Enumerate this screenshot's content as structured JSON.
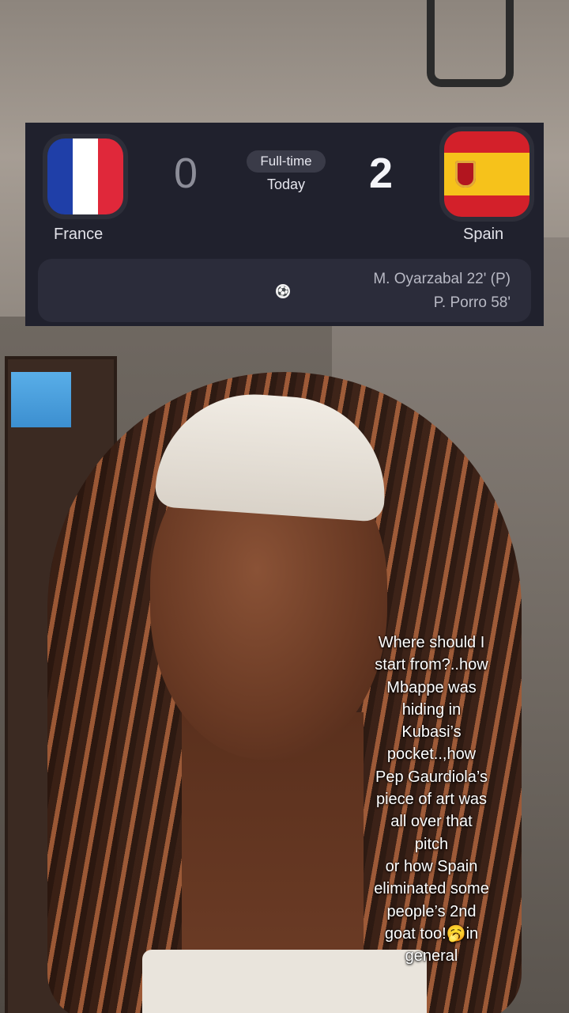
{
  "match": {
    "home_team": "France",
    "away_team": "Spain",
    "home_score": "0",
    "away_score": "2",
    "status": "Full-time",
    "date": "Today",
    "home_flag_colors": [
      "#1f3fa8",
      "#ffffff",
      "#e0283a"
    ],
    "away_flag_colors": [
      "#d3202a",
      "#f6c21b",
      "#d3202a"
    ],
    "scorers_icon": "soccer-ball-icon",
    "scorers": [
      "M. Oyarzabal 22' (P)",
      "P. Porro 58'"
    ]
  },
  "caption": {
    "lines": [
      "Where should I",
      "start from?..how",
      "Mbappe was",
      "hiding in",
      "Kubasi’s",
      "pocket..,how",
      "Pep Gaurdiola’s",
      "piece of art was",
      "all over that",
      "pitch",
      "or how Spain",
      "eliminated some",
      "people’s 2nd",
      "goat too!🥱in",
      "general"
    ]
  }
}
